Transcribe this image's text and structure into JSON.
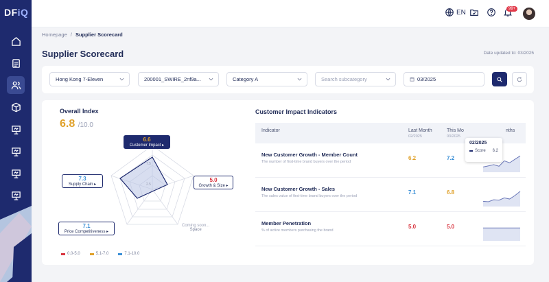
{
  "app": {
    "logo_main": "DF",
    "logo_accent": "iQ"
  },
  "topbar": {
    "lang": "EN",
    "notif_badge": "99+"
  },
  "breadcrumb": {
    "home": "Homepage",
    "sep": "/",
    "current": "Supplier Scorecard"
  },
  "page": {
    "title": "Supplier Scorecard",
    "updated": "Date updated to: 03/2025"
  },
  "filters": {
    "store": "Hong Kong 7-Eleven",
    "supplier": "200001_SWIRE_2nf9a...",
    "category": "Category A",
    "subcategory_placeholder": "Search subcategory",
    "period": "03/2025"
  },
  "overall": {
    "title": "Overall Index",
    "score": "6.8",
    "max": "/10.0",
    "axes": [
      {
        "value": "6.6",
        "label": "Customer Impact ▸",
        "color": "#e0a12a",
        "active": true
      },
      {
        "value": "5.0",
        "label": "Growth & Size ▸",
        "color": "#d8343f"
      },
      {
        "value": "7.3",
        "label": "Supply Chain ▸",
        "color": "#3a8fd6"
      },
      {
        "value": "7.1",
        "label": "Price Competitiveness ▸",
        "color": "#3a8fd6"
      }
    ],
    "coming_soon": "Coming soon...",
    "coming_label": "Space",
    "legend": [
      {
        "label": "0.0-5.0",
        "color": "#d8343f"
      },
      {
        "label": "5.1-7.0",
        "color": "#e0a12a"
      },
      {
        "label": "7.1-10.0",
        "color": "#3a8fd6"
      }
    ]
  },
  "impact": {
    "title": "Customer Impact Indicators",
    "headers": {
      "indicator": "Indicator",
      "last": "Last Month",
      "last_date": "02/2025",
      "this": "This Mo",
      "this_date": "03/2025",
      "trend": "nths"
    },
    "rows": [
      {
        "name": "New Customer Growth - Member Count",
        "desc": "The number of first-time brand buyers over the period",
        "last": "6.2",
        "last_color": "#e0a12a",
        "this": "7.2",
        "this_color": "#3a8fd6",
        "trend": [
          3,
          3.3,
          3.6,
          3.2,
          4.6,
          4.1,
          5.0,
          5.9
        ]
      },
      {
        "name": "New Customer Growth - Sales",
        "desc": "The sales value of first-time brand buyers over the period",
        "last": "7.1",
        "last_color": "#3a8fd6",
        "this": "6.8",
        "this_color": "#e0a12a",
        "trend": [
          3,
          2.9,
          3.4,
          3.3,
          3.9,
          3.6,
          4.5,
          5.6
        ]
      },
      {
        "name": "Member Penetration",
        "desc": "% of active members purchasing the brand",
        "last": "5.0",
        "last_color": "#d8343f",
        "this": "5.0",
        "this_color": "#d8343f",
        "trend": [
          5.0,
          5.0,
          5.0,
          5.0,
          5.0,
          5.0,
          5.0,
          5.0
        ]
      }
    ],
    "tooltip": {
      "date": "02/2025",
      "series": "Score",
      "value": "6.2"
    }
  }
}
